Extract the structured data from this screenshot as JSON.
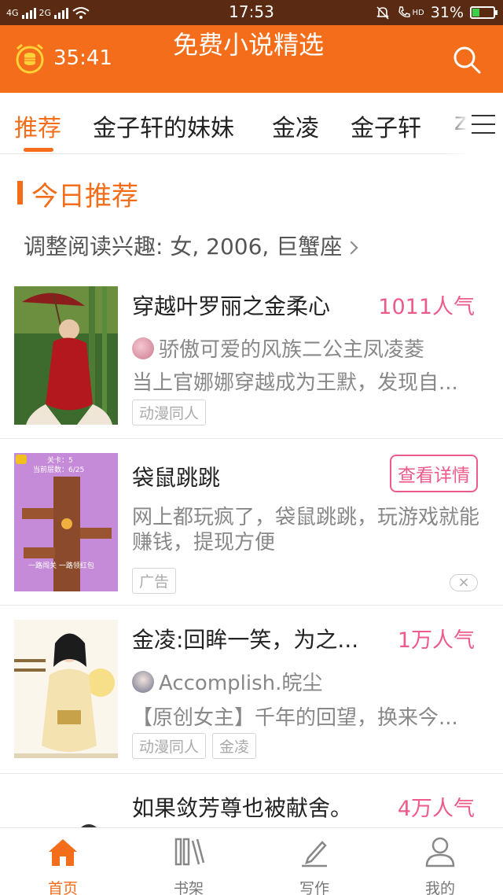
{
  "status_bar": {
    "network_left": "4G",
    "network_right": "2G",
    "time": "17:53",
    "battery_percent_text": "31%",
    "battery_level": 0.31,
    "hd_label": "HD"
  },
  "header": {
    "timer": "35:41",
    "title": "免费小说精选",
    "accent_color": "#f36d1a"
  },
  "tabs": [
    {
      "label": "推荐",
      "active": true
    },
    {
      "label": "金子轩的妹妹",
      "active": false
    },
    {
      "label": "金凌",
      "active": false
    },
    {
      "label": "金子轩",
      "active": false
    },
    {
      "label": "z",
      "active": false
    }
  ],
  "section": {
    "title": "今日推荐",
    "interest_text": "调整阅读兴趣: 女, 2006, 巨蟹座"
  },
  "items": [
    {
      "type": "book",
      "title": "穿越叶罗丽之金柔心",
      "popularity": "1011人气",
      "author": "骄傲可爱的风族二公主凤凌菱",
      "description": "当上官娜娜穿越成为王默，发现自...",
      "tags": [
        "动漫同人"
      ]
    },
    {
      "type": "ad",
      "title": "袋鼠跳跳",
      "button": "查看详情",
      "description": "网上都玩疯了，袋鼠跳跳，玩游戏就能赚钱，提现方便",
      "tag": "广告",
      "close_symbol": "×",
      "cover_text_top": "关卡：5",
      "cover_text_sub": "当前层数：6/25",
      "cover_text_bottom": "一路闯关 一路领红包"
    },
    {
      "type": "book",
      "title": "金凌:回眸一笑，为之...",
      "popularity": "1万人气",
      "author": "Accomplish.皖尘",
      "description": "【原创女主】千年的回望，换来今...",
      "tags": [
        "动漫同人",
        "金凌"
      ]
    },
    {
      "type": "book",
      "title": "如果敛芳尊也被献舍。",
      "popularity": "4万人气"
    }
  ],
  "bottom_nav": [
    {
      "label": "首页",
      "icon": "home-icon",
      "active": true
    },
    {
      "label": "书架",
      "icon": "bookshelf-icon",
      "active": false
    },
    {
      "label": "写作",
      "icon": "pen-icon",
      "active": false
    },
    {
      "label": "我的",
      "icon": "user-icon",
      "active": false
    }
  ]
}
